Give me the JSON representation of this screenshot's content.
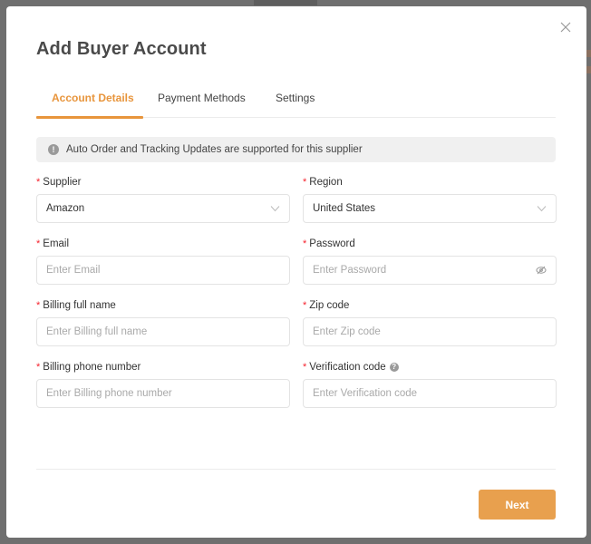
{
  "modal": {
    "title": "Add Buyer Account",
    "close_icon": "close-icon"
  },
  "tabs": [
    {
      "label": "Account Details",
      "active": true
    },
    {
      "label": "Payment Methods",
      "active": false
    },
    {
      "label": "Settings",
      "active": false
    }
  ],
  "alert": {
    "icon": "exclamation-circle-icon",
    "text": "Auto Order and Tracking Updates are supported for this supplier"
  },
  "form": {
    "required_mark": "*",
    "supplier": {
      "label": "Supplier",
      "value": "Amazon",
      "icon": "chevron-down-icon"
    },
    "region": {
      "label": "Region",
      "value": "United States",
      "icon": "chevron-down-icon"
    },
    "email": {
      "label": "Email",
      "value": "",
      "placeholder": "Enter Email"
    },
    "password": {
      "label": "Password",
      "value": "",
      "placeholder": "Enter Password",
      "icon": "eye-off-icon"
    },
    "billing_full_name": {
      "label": "Billing full name",
      "value": "",
      "placeholder": "Enter Billing full name"
    },
    "zip_code": {
      "label": "Zip code",
      "value": "",
      "placeholder": "Enter Zip code"
    },
    "billing_phone": {
      "label": "Billing phone number",
      "value": "",
      "placeholder": "Enter Billing phone number"
    },
    "verification_code": {
      "label": "Verification code",
      "value": "",
      "placeholder": "Enter Verification code",
      "help_icon": "question-circle-icon",
      "help_glyph": "?"
    }
  },
  "footer": {
    "next_label": "Next"
  },
  "colors": {
    "accent": "#e8953c",
    "button": "#e8a04e",
    "required": "#f5222d"
  }
}
